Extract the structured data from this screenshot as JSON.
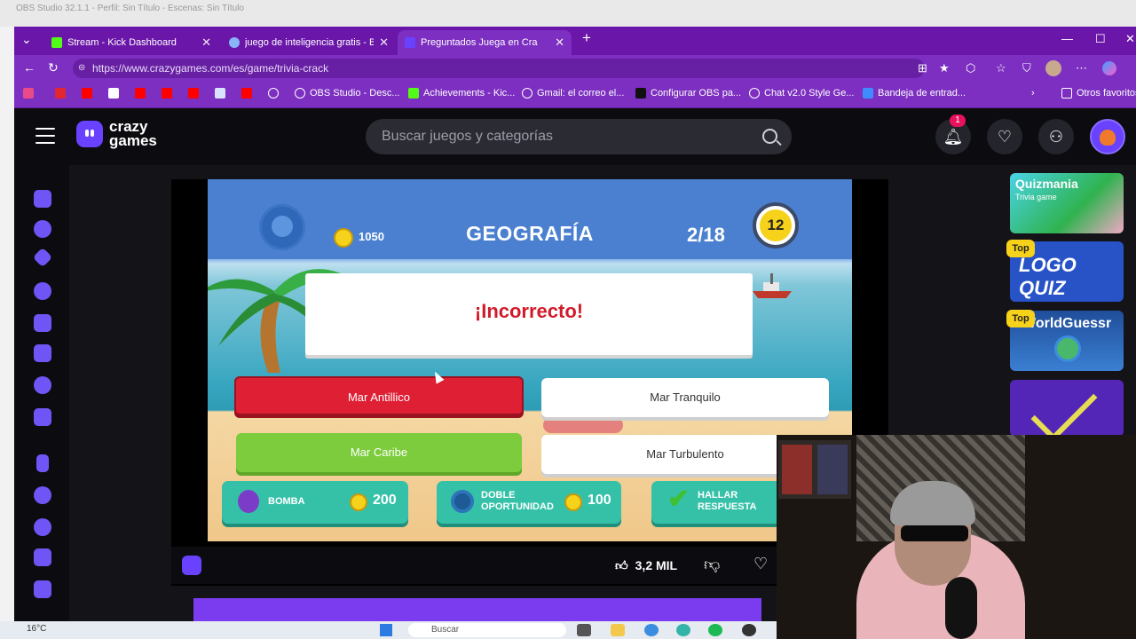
{
  "obs_title": "OBS Studio 32.1.1 - Perfil: Sin Título - Escenas: Sin Título",
  "tabs": [
    {
      "label": "Stream - Kick Dashboard",
      "color": "#53fc18"
    },
    {
      "label": "juego de inteligencia gratis - Búsq",
      "color": "#8ab4f8"
    },
    {
      "label": "Preguntados   Juega en Cra",
      "color": "#6842ff"
    }
  ],
  "url": "https://www.crazygames.com/es/game/trivia-crack",
  "bookmarks": [
    "OBS Studio - Desc...",
    "Achievements - Kic...",
    "Gmail: el correo el...",
    "Configurar OBS pa...",
    "Chat v2.0 Style Ge...",
    "Bandeja de entrad..."
  ],
  "other_bookmarks": "Otros favoritos",
  "site": {
    "logo_line1": "crazy",
    "logo_line2": "games",
    "search_placeholder": "Buscar juegos y categorías",
    "notification_count": "1"
  },
  "game": {
    "coins": "1050",
    "category": "GEOGRAFÍA",
    "progress": "2/18",
    "timer": "12",
    "result": "¡Incorrecto!",
    "answers": [
      "Mar Antillico",
      "Mar Tranquilo",
      "Mar Caribe",
      "Mar Turbulento"
    ],
    "powerups": [
      {
        "label": "BOMBA",
        "price": "200"
      },
      {
        "label_line1": "DOBLE",
        "label_line2": "OPORTUNIDAD",
        "price": "100"
      },
      {
        "label_line1": "HALLAR",
        "label_line2": "RESPUESTA"
      }
    ],
    "likes": "3,2 MIL"
  },
  "sidebar_games": [
    {
      "title": "Quizmania",
      "subtitle": "Trivia game"
    },
    {
      "tag": "Top",
      "title": "LOGO QUIZ"
    },
    {
      "tag": "Top",
      "title": "WorldGuessr"
    }
  ],
  "taskbar": {
    "weather": "16°C",
    "search": "Buscar"
  }
}
